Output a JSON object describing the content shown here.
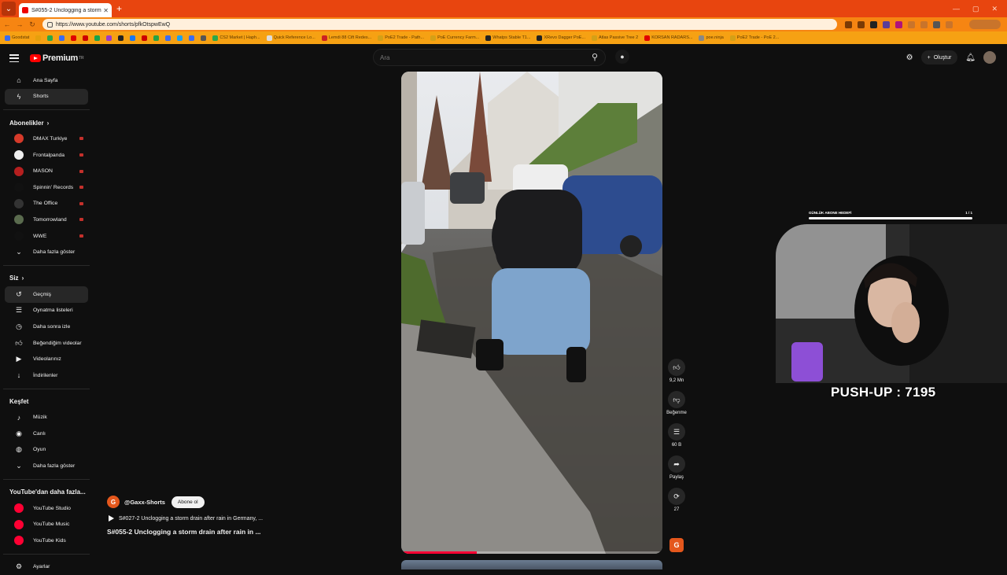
{
  "browser": {
    "tab_title": "S#055-2 Unclogging a storm",
    "url": "https://www.youtube.com/shorts/pfkOtspwEwQ",
    "bookmarks": [
      {
        "label": "Goodstat",
        "color": "#3b6df0"
      },
      {
        "label": "",
        "color": "#e5a00d"
      },
      {
        "label": "",
        "color": "#2aa84a"
      },
      {
        "label": "",
        "color": "#3b6df0"
      },
      {
        "label": "",
        "color": "#e00000"
      },
      {
        "label": "",
        "color": "#cc0000"
      },
      {
        "label": "",
        "color": "#19a34a"
      },
      {
        "label": "",
        "color": "#9b3cc7"
      },
      {
        "label": "",
        "color": "#222222"
      },
      {
        "label": "",
        "color": "#1877f2"
      },
      {
        "label": "",
        "color": "#cc0000"
      },
      {
        "label": "",
        "color": "#25a244"
      },
      {
        "label": "",
        "color": "#3b6df0"
      },
      {
        "label": "",
        "color": "#1da1f2"
      },
      {
        "label": "",
        "color": "#3b6df0"
      },
      {
        "label": "",
        "color": "#555555"
      },
      {
        "label": "CS2 Market | Haph...",
        "color": "#2aa84a"
      },
      {
        "label": "Quick Reference Lo...",
        "color": "#dddddd"
      },
      {
        "label": "Lemdi 88 Cift Redes...",
        "color": "#cc2222"
      },
      {
        "label": "PoE2 Trade - Path...",
        "color": "#d4a017"
      },
      {
        "label": "PoE Currency Farm...",
        "color": "#d4a017"
      },
      {
        "label": "Whatps Stable T1...",
        "color": "#222222"
      },
      {
        "label": "XRevo Dagger PoE...",
        "color": "#222222"
      },
      {
        "label": "Atlas Passive Tree 2",
        "color": "#d4a017"
      },
      {
        "label": "KORSAN RADARS...",
        "color": "#e00000"
      },
      {
        "label": "poe.ninja",
        "color": "#888888"
      },
      {
        "label": "PoE2 Trade - PoE 2...",
        "color": "#d4a017"
      }
    ]
  },
  "masthead": {
    "logo_text": "Premium",
    "logo_region": "TR",
    "search_placeholder": "Ara",
    "create_label": "Oluştur"
  },
  "sidebar": {
    "main": [
      {
        "label": "Ana Sayfa",
        "icon": "home-icon"
      },
      {
        "label": "Shorts",
        "icon": "shorts-icon",
        "active": true
      }
    ],
    "subscriptions_header": "Abonelikler",
    "subscriptions": [
      {
        "label": "DMAX Turkiye",
        "color": "#d63a2a",
        "live": true
      },
      {
        "label": "Frontalpanda",
        "color": "#eeeeee",
        "live": true
      },
      {
        "label": "MASON",
        "color": "#b51f1f",
        "live": true
      },
      {
        "label": "Spinnin' Records",
        "color": "#111111",
        "live": true
      },
      {
        "label": "The Office",
        "color": "#333333",
        "live": true
      },
      {
        "label": "Tomorrowland",
        "color": "#5a6b4e",
        "live": true
      },
      {
        "label": "WWE",
        "color": "#111111",
        "live": true
      }
    ],
    "subs_more": "Daha fazla göster",
    "you_header": "Siz",
    "you": [
      {
        "label": "Geçmiş",
        "icon": "history-icon",
        "active": true
      },
      {
        "label": "Oynatma listeleri",
        "icon": "playlist-icon"
      },
      {
        "label": "Daha sonra izle",
        "icon": "watch-later-icon"
      },
      {
        "label": "Beğendiğim videolar",
        "icon": "like-icon"
      },
      {
        "label": "Videolarınız",
        "icon": "your-videos-icon"
      },
      {
        "label": "İndirilenler",
        "icon": "download-icon"
      }
    ],
    "explore_header": "Keşfet",
    "explore": [
      {
        "label": "Müzik",
        "icon": "music-icon"
      },
      {
        "label": "Canlı",
        "icon": "live-icon"
      },
      {
        "label": "Oyun",
        "icon": "gaming-icon"
      }
    ],
    "explore_more": "Daha fazla göster",
    "more_header": "YouTube'dan daha fazla...",
    "more": [
      {
        "label": "YouTube Studio",
        "color": "#ff0033"
      },
      {
        "label": "YouTube Music",
        "color": "#ff0033"
      },
      {
        "label": "YouTube Kids",
        "color": "#ff0033"
      }
    ],
    "settings_label": "Ayarlar"
  },
  "video": {
    "channel_initial": "G",
    "channel_name": "@Gaxx-Shorts",
    "subscribe_label": "Abone ol",
    "playlist_text": "S#027-2  Unclogging a storm drain after rain in Germany, ...",
    "title": "S#055-2  Unclogging a storm drain after rain in ...",
    "progress": 0.29
  },
  "actions": {
    "like_count": "9,2 Mn",
    "dislike_label": "Beğenme",
    "comments_count": "60 B",
    "share_label": "Paylaş",
    "remix_count": "27"
  },
  "overlay": {
    "goal_label": "GÜNLÜK ABONE HEDEFİ",
    "goal_count": "1 / 1",
    "pushup_text": "PUSH-UP : 7195"
  }
}
